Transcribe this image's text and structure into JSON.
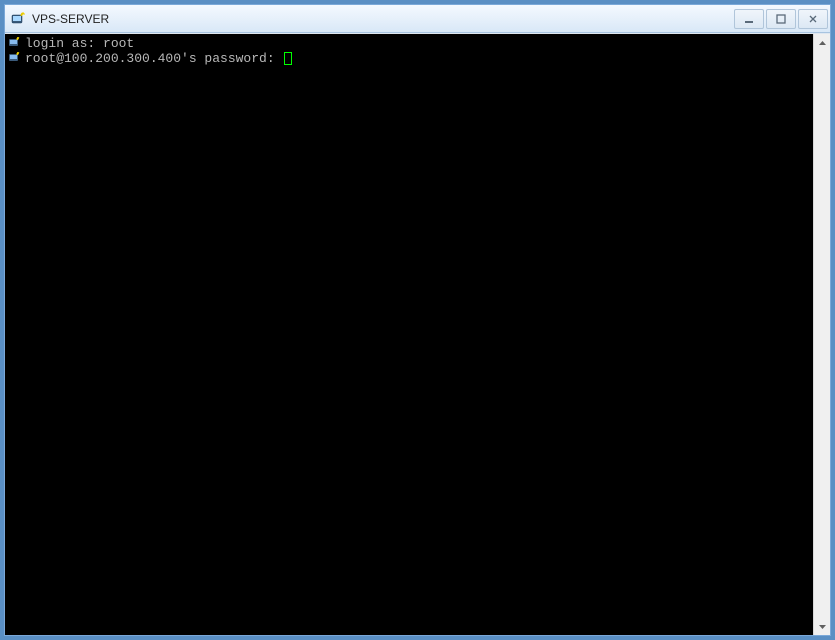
{
  "window": {
    "title": "VPS-SERVER"
  },
  "terminal": {
    "lines": [
      {
        "prompt": "login as: ",
        "input": "root"
      },
      {
        "prompt": "root@100.200.300.400's password: ",
        "input": ""
      }
    ]
  }
}
